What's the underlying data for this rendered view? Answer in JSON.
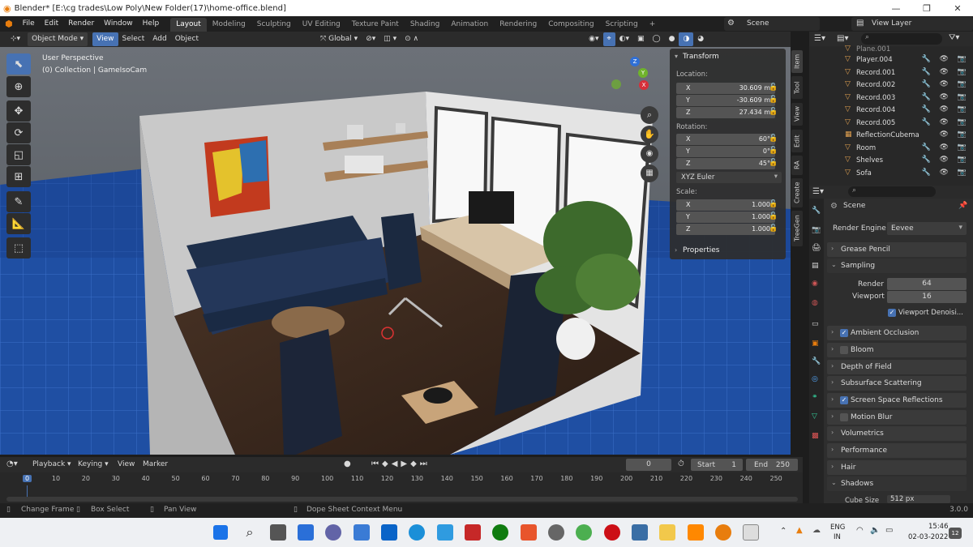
{
  "window": {
    "title": "Blender* [E:\\cg trades\\Low Poly\\New Folder(17)\\home-office.blend]",
    "minimize": "—",
    "maximize": "❐",
    "close": "✕"
  },
  "menubar": {
    "items": [
      "File",
      "Edit",
      "Render",
      "Window",
      "Help"
    ],
    "workspaces": [
      "Layout",
      "Modeling",
      "Sculpting",
      "UV Editing",
      "Texture Paint",
      "Shading",
      "Animation",
      "Rendering",
      "Compositing",
      "Scripting"
    ],
    "active_workspace": "Layout",
    "add_workspace": "+",
    "scene": "Scene",
    "view_layer": "View Layer"
  },
  "viewport_header": {
    "mode": "Object Mode",
    "menus": [
      "View",
      "Select",
      "Add",
      "Object"
    ],
    "active_menu": "View",
    "orientation": "Global"
  },
  "viewport": {
    "perspective": "User Perspective",
    "collection": "(0) Collection | GameIsoCam",
    "gizmo": {
      "x": "X",
      "y": "Y",
      "z": "Z"
    }
  },
  "npanel": {
    "transform_title": "Transform",
    "location_label": "Location:",
    "location": [
      {
        "axis": "X",
        "value": "30.609 m"
      },
      {
        "axis": "Y",
        "value": "-30.609 m"
      },
      {
        "axis": "Z",
        "value": "27.434 m"
      }
    ],
    "rotation_label": "Rotation:",
    "rotation": [
      {
        "axis": "X",
        "value": "60°"
      },
      {
        "axis": "Y",
        "value": "0°"
      },
      {
        "axis": "Z",
        "value": "45°"
      }
    ],
    "rotation_mode": "XYZ Euler",
    "scale_label": "Scale:",
    "scale": [
      {
        "axis": "X",
        "value": "1.000"
      },
      {
        "axis": "Y",
        "value": "1.000"
      },
      {
        "axis": "Z",
        "value": "1.000"
      }
    ],
    "properties_title": "Properties",
    "tabs": [
      "Item",
      "Tool",
      "View",
      "Edit",
      "RA",
      "Create",
      "TreeGen"
    ]
  },
  "outliner": {
    "rows": [
      {
        "name": "Plane.001",
        "icon": "mesh-icon"
      },
      {
        "name": "Player.004",
        "icon": "mesh-icon"
      },
      {
        "name": "Record.001",
        "icon": "mesh-icon"
      },
      {
        "name": "Record.002",
        "icon": "mesh-icon"
      },
      {
        "name": "Record.003",
        "icon": "mesh-icon"
      },
      {
        "name": "Record.004",
        "icon": "mesh-icon"
      },
      {
        "name": "Record.005",
        "icon": "mesh-icon"
      },
      {
        "name": "ReflectionCubema",
        "icon": "probe-icon"
      },
      {
        "name": "Room",
        "icon": "mesh-icon"
      },
      {
        "name": "Shelves",
        "icon": "mesh-icon"
      },
      {
        "name": "Sofa",
        "icon": "mesh-icon"
      }
    ]
  },
  "properties": {
    "context": "Scene",
    "render_engine_label": "Render Engine",
    "render_engine": "Eevee",
    "sampling": {
      "title": "Sampling",
      "render_label": "Render",
      "render_value": "64",
      "viewport_label": "Viewport",
      "viewport_value": "16",
      "denoise_label": "Viewport Denoisi..."
    },
    "sections": [
      {
        "title": "Grease Pencil",
        "checkbox": null
      },
      {
        "title": "Ambient Occlusion",
        "checkbox": true
      },
      {
        "title": "Bloom",
        "checkbox": false
      },
      {
        "title": "Depth of Field",
        "checkbox": null
      },
      {
        "title": "Subsurface Scattering",
        "checkbox": null
      },
      {
        "title": "Screen Space Reflections",
        "checkbox": true
      },
      {
        "title": "Motion Blur",
        "checkbox": false
      },
      {
        "title": "Volumetrics",
        "checkbox": null
      },
      {
        "title": "Performance",
        "checkbox": null
      },
      {
        "title": "Hair",
        "checkbox": null
      },
      {
        "title": "Shadows",
        "checkbox": null
      }
    ],
    "cube_size_label": "Cube Size",
    "cube_size": "512 px"
  },
  "timeline": {
    "menus": [
      "Playback",
      "Keying",
      "View",
      "Marker"
    ],
    "current_frame": "0",
    "start_label": "Start",
    "start": "1",
    "end_label": "End",
    "end": "250",
    "ruler": [
      "0",
      "10",
      "20",
      "30",
      "40",
      "50",
      "60",
      "70",
      "80",
      "90",
      "100",
      "110",
      "120",
      "130",
      "140",
      "150",
      "160",
      "170",
      "180",
      "190",
      "200",
      "210",
      "220",
      "230",
      "240",
      "250"
    ]
  },
  "statusbar": {
    "change_frame": "Change Frame",
    "box_select": "Box Select",
    "pan_view": "Pan View",
    "context_menu": "Dope Sheet Context Menu",
    "version": "3.0.0"
  },
  "taskbar": {
    "lang1": "ENG",
    "lang2": "IN",
    "time": "15:46",
    "date": "02-03-2022",
    "notification": "12"
  }
}
